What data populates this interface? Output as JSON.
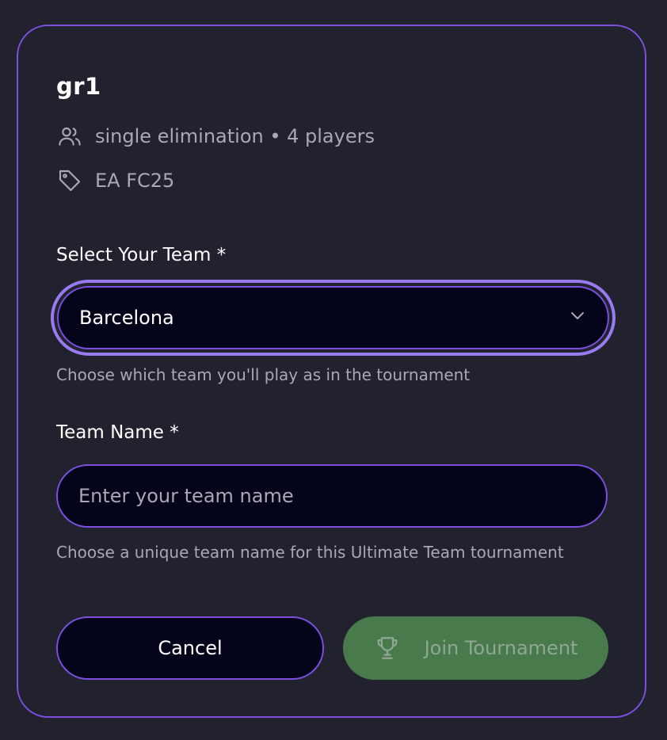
{
  "dialog": {
    "title": "gr1",
    "meta": {
      "players_text": "single elimination • 4 players",
      "players_icon": "users-icon",
      "game_text": "EA FC25",
      "game_icon": "tag-icon"
    },
    "team_select": {
      "label": "Select Your Team *",
      "value": "Barcelona",
      "helper": "Choose which team you'll play as in the tournament",
      "icon": "chevron-down-icon"
    },
    "team_name": {
      "label": "Team Name *",
      "placeholder": "Enter your team name",
      "value": "",
      "helper": "Choose a unique team name for this Ultimate Team tournament"
    },
    "buttons": {
      "cancel_label": "Cancel",
      "join_label": "Join Tournament",
      "join_icon": "trophy-icon"
    }
  },
  "colors": {
    "background": "#22222e",
    "accent": "#7c4fe0",
    "field_bg": "#04041a",
    "join_bg": "#487a4b",
    "muted_text": "#a8a8b6"
  }
}
